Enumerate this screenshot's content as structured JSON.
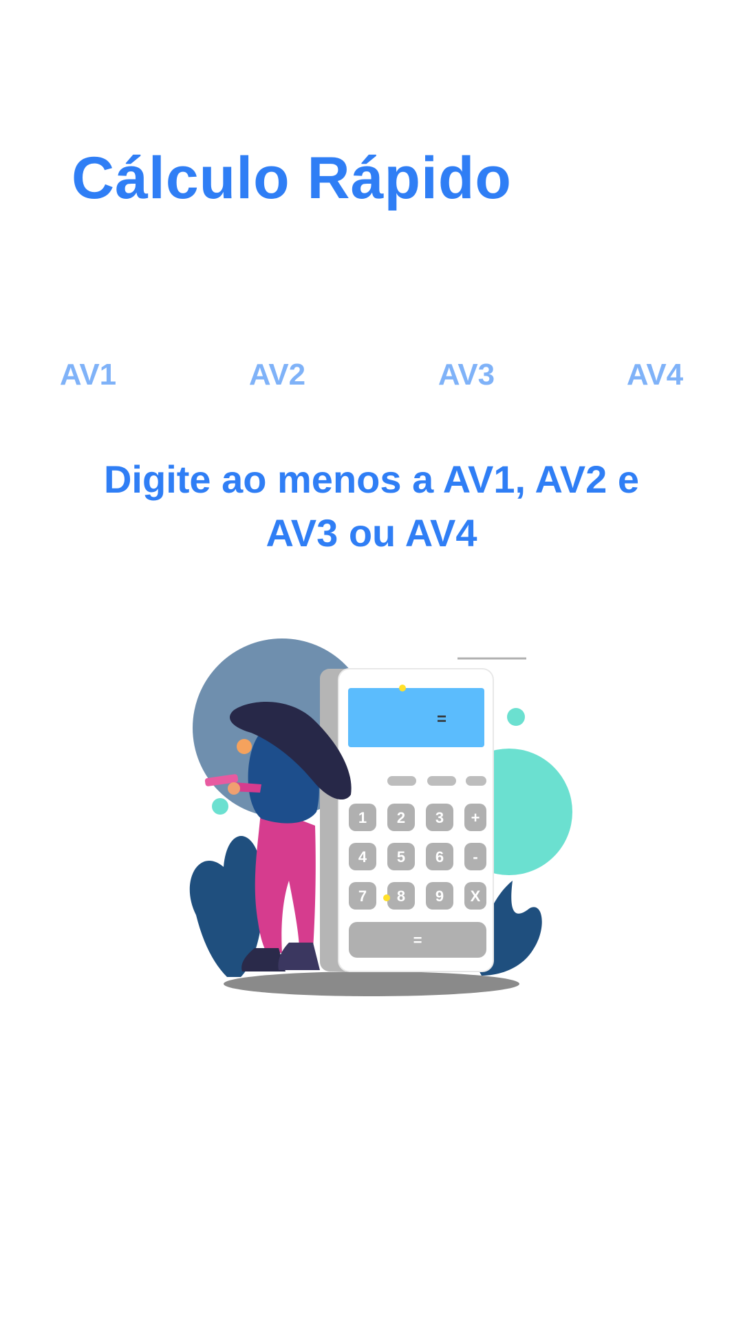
{
  "header": {
    "title": "Cálculo Rápido"
  },
  "grades": {
    "fields": [
      {
        "label": "AV1"
      },
      {
        "label": "AV2"
      },
      {
        "label": "AV3"
      },
      {
        "label": "AV4"
      }
    ]
  },
  "hint": {
    "line1": "Digite ao menos a AV1, AV2 e",
    "line2": "AV3 ou AV4"
  },
  "illustration": {
    "icon": "woman-with-calculator-illustration",
    "calculator_display": "=",
    "keys": [
      "1",
      "2",
      "3",
      "+",
      "4",
      "5",
      "6",
      "-",
      "7",
      "8",
      "9",
      "X"
    ],
    "equals_key": "="
  },
  "colors": {
    "primary": "#2f7ef5",
    "label": "#7fb2f8",
    "display": "#5bbcfd",
    "teal": "#6be0d0",
    "navy": "#1f4f7e",
    "pink": "#d63c8e"
  }
}
